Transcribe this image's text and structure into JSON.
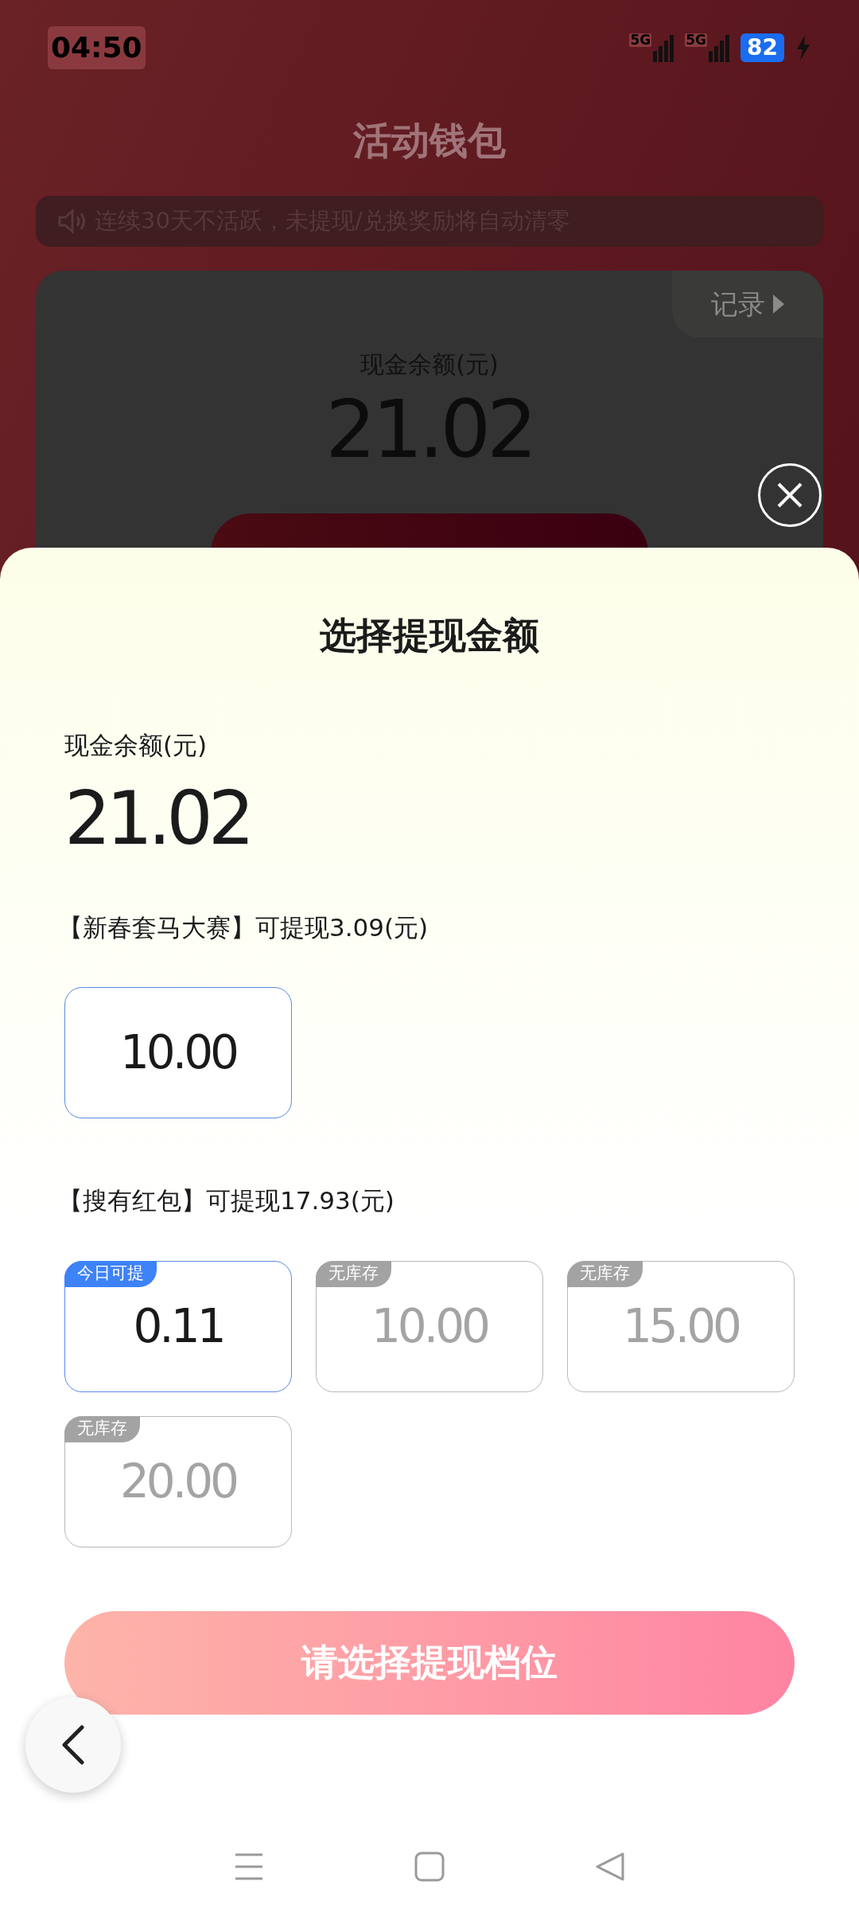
{
  "status_bar": {
    "time": "04:50",
    "network_labels": [
      "5G",
      "5G"
    ],
    "battery": "82"
  },
  "page": {
    "title": "活动钱包",
    "notice": "连续30天不活跃，未提现/兑换奖励将自动清零",
    "card": {
      "record_link": "记录",
      "balance_label": "现金余额(元)",
      "balance": "21.02"
    }
  },
  "sheet": {
    "title": "选择提现金额",
    "balance_label": "现金余额(元)",
    "balance": "21.02",
    "groups": [
      {
        "heading": "【新春套马大赛】可提现3.09(元)",
        "options": [
          {
            "amount": "10.00",
            "available": true
          }
        ]
      },
      {
        "heading": "【搜有红包】可提现17.93(元)",
        "options": [
          {
            "amount": "0.11",
            "available": true,
            "tag": "今日可提"
          },
          {
            "amount": "10.00",
            "available": false,
            "tag": "无库存"
          },
          {
            "amount": "15.00",
            "available": false,
            "tag": "无库存"
          },
          {
            "amount": "20.00",
            "available": false,
            "tag": "无库存"
          }
        ]
      }
    ],
    "submit_button": "请选择提现档位"
  }
}
